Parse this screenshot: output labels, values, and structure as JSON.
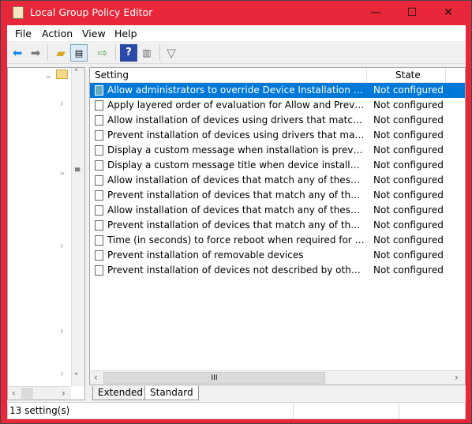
{
  "window": {
    "title": "Local Group Policy Editor",
    "minimize": "—",
    "maximize": "☐",
    "close": "✕"
  },
  "menu": [
    "File",
    "Action",
    "View",
    "Help"
  ],
  "list": {
    "columns": [
      "Setting",
      "State"
    ],
    "rows": [
      {
        "name": "Allow administrators to override Device Installation Restriction policies",
        "state": "Not configured",
        "selected": true
      },
      {
        "name": "Apply layered order of evaluation for Allow and Prevent device installation policies across all device match criteria",
        "state": "Not configured"
      },
      {
        "name": "Allow installation of devices using drivers that match these device setup classes",
        "state": "Not configured"
      },
      {
        "name": "Prevent installation of devices using drivers that match these device setup classes",
        "state": "Not configured"
      },
      {
        "name": "Display a custom message when installation is prevented by a policy setting",
        "state": "Not configured"
      },
      {
        "name": "Display a custom message title when device installation is prevented by a policy setting",
        "state": "Not configured"
      },
      {
        "name": "Allow installation of devices that match any of these device IDs",
        "state": "Not configured"
      },
      {
        "name": "Prevent installation of devices that match any of these device IDs",
        "state": "Not configured"
      },
      {
        "name": "Allow installation of devices that match any of these device instance IDs",
        "state": "Not configured"
      },
      {
        "name": "Prevent installation of devices that match any of these device instance IDs",
        "state": "Not configured"
      },
      {
        "name": "Time (in seconds) to force reboot when required for policy changes to take effect",
        "state": "Not configured"
      },
      {
        "name": "Prevent installation of removable devices",
        "state": "Not configured"
      },
      {
        "name": "Prevent installation of devices not described by other policy settings",
        "state": "Not configured"
      }
    ]
  },
  "tabs": [
    "Extended",
    "Standard"
  ],
  "status": "13 setting(s)",
  "colors": {
    "titlebar": "#e8283a",
    "selection": "#0078d7"
  }
}
